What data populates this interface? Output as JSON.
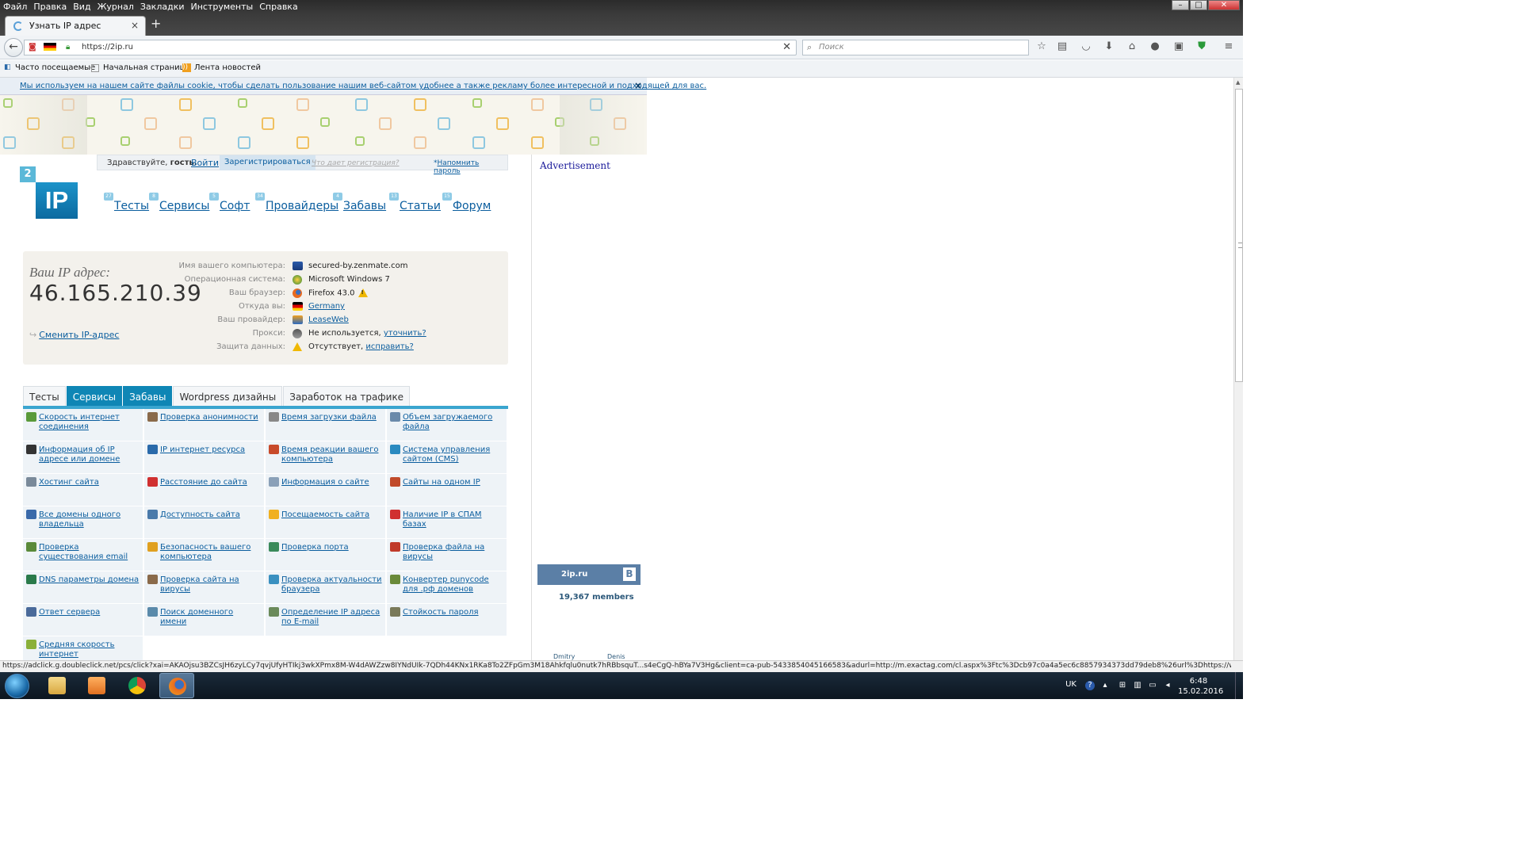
{
  "menu": [
    "Файл",
    "Правка",
    "Вид",
    "Журнал",
    "Закладки",
    "Инструменты",
    "Справка"
  ],
  "tab": {
    "title": "Узнать IP адрес",
    "close": "×",
    "new": "+"
  },
  "address": {
    "url": "https://2ip.ru",
    "clear": "✕"
  },
  "search": {
    "placeholder": "Поиск"
  },
  "bookmarks": [
    "Часто посещаемые",
    "Начальная страница",
    "Лента новостей"
  ],
  "cookie": {
    "text": "Мы используем на нашем сайте файлы cookie, чтобы сделать пользование нашим веб-сайтом удобнее а также рекламу более интересной и подходящей для вас.",
    "close": "×"
  },
  "login": {
    "greeting_prefix": "Здравствуйте, ",
    "greeting_name": "гость.",
    "login": "Войти",
    "register": "Зарегистрироваться",
    "why": "Что дает регистрация?",
    "remind_prefix": "* ",
    "remind": "Напомнить пароль"
  },
  "logo": {
    "badge": "2",
    "text": "IP"
  },
  "nav": [
    {
      "label": "Тесты",
      "badge": "27"
    },
    {
      "label": "Сервисы",
      "badge": "8"
    },
    {
      "label": "Софт",
      "badge": "5"
    },
    {
      "label": "Провайдеры",
      "badge": "34"
    },
    {
      "label": "Забавы",
      "badge": "4"
    },
    {
      "label": "Статьи",
      "badge": "13"
    },
    {
      "label": "Форум",
      "badge": "15"
    }
  ],
  "ip": {
    "label": "Ваш IP адрес:",
    "value": "46.165.210.39",
    "change": "Сменить IP-адрес",
    "rows": [
      {
        "label": "Имя вашего компьютера:",
        "value": "secured-by.zenmate.com",
        "link": ""
      },
      {
        "label": "Операционная система:",
        "value": "Microsoft Windows 7",
        "link": ""
      },
      {
        "label": "Ваш браузер:",
        "value": "Firefox 43.0",
        "link": ""
      },
      {
        "label": "Откуда вы:",
        "value": "",
        "link": "Germany"
      },
      {
        "label": "Ваш провайдер:",
        "value": "",
        "link": "LeaseWeb"
      },
      {
        "label": "Прокси:",
        "value": "Не используется, ",
        "link": "уточнить?"
      },
      {
        "label": "Защита данных:",
        "value": "Отсутствует, ",
        "link": "исправить?"
      }
    ]
  },
  "tabs": [
    "Тесты",
    "Сервисы",
    "Забавы",
    "Wordpress дизайны",
    "Заработок на трафике"
  ],
  "grid": [
    [
      "Скорость интернет соединения",
      "Проверка анонимности",
      "Время загрузки файла",
      "Объем загружаемого файла"
    ],
    [
      "Информация об IP адресе или домене",
      "IP интернет ресурса",
      "Время реакции вашего компьютера",
      "Система управления сайтом (CMS)"
    ],
    [
      "Хостинг сайта",
      "Расстояние до сайта",
      "Информация о сайте",
      "Сайты на одном IP"
    ],
    [
      "Все домены одного владельца",
      "Доступность сайта",
      "Посещаемость сайта",
      "Наличие IP в СПАМ базах"
    ],
    [
      "Проверка существования email",
      "Безопасность вашего компьютера",
      "Проверка порта",
      "Проверка файла на вирусы"
    ],
    [
      "DNS параметры домена",
      "Проверка сайта на вирусы",
      "Проверка актуальности браузера",
      "Конвертер punycode для .рф доменов"
    ],
    [
      "Ответ сервера",
      "Поиск доменного имени",
      "Определение IP адреса по E-mail",
      "Стойкость пароля"
    ],
    [
      "Средняя скорость интернет",
      "",
      "",
      ""
    ]
  ],
  "sidebar": {
    "ad": "Advertisement",
    "vk_name": "2ip.ru",
    "vk_badge": "B",
    "vk_members": "19,367 members",
    "vk_user1": "Dmitry",
    "vk_user2": "Denis"
  },
  "status": "https://adclick.g.doubleclick.net/pcs/click?xai=AKAOjsu3BZCsJH6zyLCy7qvjUfyHTIkj3wkXPmx8M-W4dAWZzw8IYNdUIk-7QDh44KNx1RKa8To2ZFpGm3M18Ahkfqlu0nutk7hRBbsquT...s4eCgQ-hBYa7V3Hg&client=ca-pub-5433854045166583&adurl=http://m.exactag.com/cl.aspx%3Ftc%3Dcb97c0a4a5ec6c8857934373dd79deb8%26url%3Dhttps://www.roller.de/",
  "taskbar": {
    "lang": "UK",
    "time": "6:48",
    "date": "15.02.2016"
  },
  "colors": {
    "accent": "#0f86b5",
    "link": "#0a5d9e",
    "panel": "#f3f1ec"
  }
}
